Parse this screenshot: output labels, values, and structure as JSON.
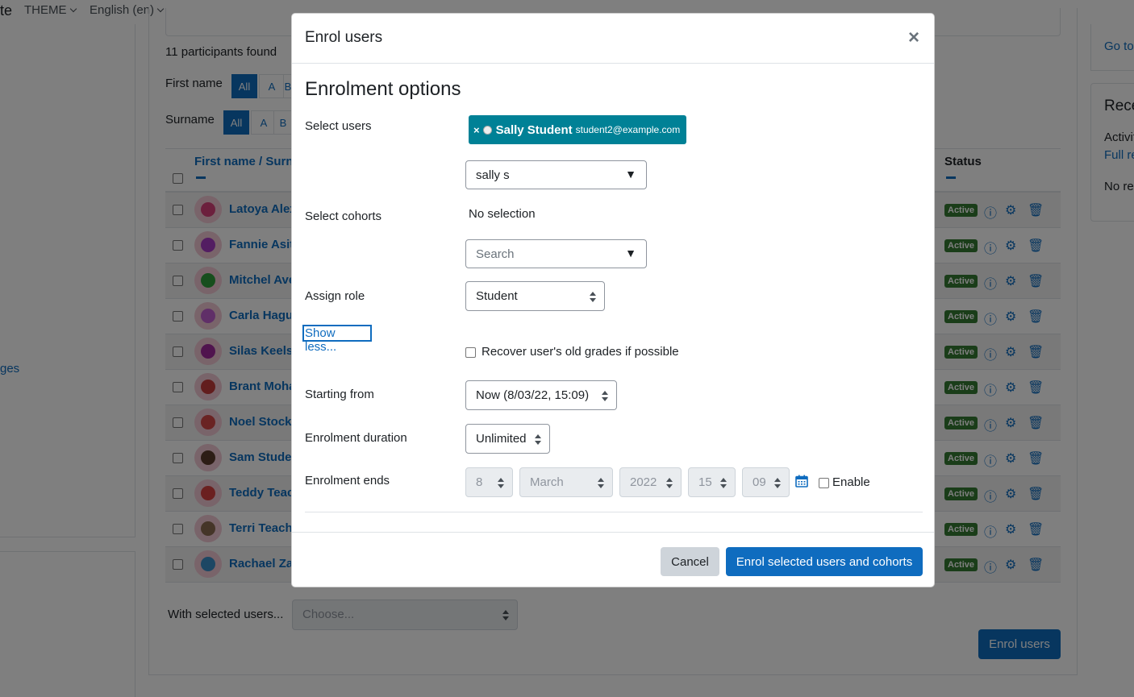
{
  "topbar": {
    "site_fragment": "te",
    "theme_label": "THEME",
    "language_label": "English (en)"
  },
  "left": {
    "link_fragment": "ges"
  },
  "participants": {
    "found": "11 participants found",
    "first_name_label": "First name",
    "surname_label": "Surname",
    "first_initials": [
      "All",
      "A",
      "B"
    ],
    "surname_initials": [
      "All",
      "A",
      "B"
    ],
    "col_name": "First name / Surn",
    "col_status": "Status",
    "rows": [
      {
        "name": "Latoya Alex",
        "status": "Active",
        "color": "#d8407a"
      },
      {
        "name": "Fannie Asit",
        "status": "Active",
        "color": "#a63ac4"
      },
      {
        "name": "Mitchel Ave",
        "status": "Active",
        "color": "#2e9c3a"
      },
      {
        "name": "Carla Hagu",
        "status": "Active",
        "color": "#c05fd0"
      },
      {
        "name": "Silas Keels",
        "status": "Active",
        "color": "#a0289c"
      },
      {
        "name": "Brant Moha",
        "status": "Active",
        "color": "#c43a3a"
      },
      {
        "name": "Noel Stock",
        "status": "Active",
        "color": "#d44646"
      },
      {
        "name": "Sam Stude",
        "status": "Active",
        "color": "#5a3a2a"
      },
      {
        "name": "Teddy Teac",
        "status": "Active",
        "color": "#d64040"
      },
      {
        "name": "Terri Teach",
        "status": "Active",
        "color": "#8a6a50"
      },
      {
        "name": "Rachael Za",
        "status": "Active",
        "color": "#3a8ec8"
      }
    ],
    "with_selected": "With selected users...",
    "choose_placeholder": "Choose...",
    "enrol_users_button": "Enrol users"
  },
  "right": {
    "goto": "Go to",
    "recent_title": "Rece",
    "activity": "Activit",
    "full_report": "Full re",
    "no_recent": "No re"
  },
  "modal": {
    "title": "Enrol users",
    "close": "×",
    "heading": "Enrolment options",
    "select_users_label": "Select users",
    "selected_user": {
      "remove": "×",
      "name": "Sally Student",
      "email": "student2@example.com"
    },
    "user_search_value": "sally s",
    "select_cohorts_label": "Select cohorts",
    "cohorts_none": "No selection",
    "cohort_search_placeholder": "Search",
    "assign_role_label": "Assign role",
    "assign_role_value": "Student",
    "show_less": "Show less...",
    "recover_grades_label": "Recover user's old grades if possible",
    "starting_from_label": "Starting from",
    "starting_from_value": "Now (8/03/22, 15:09)",
    "duration_label": "Enrolment duration",
    "duration_value": "Unlimited",
    "ends_label": "Enrolment ends",
    "ends": {
      "day": "8",
      "month": "March",
      "year": "2022",
      "hour": "15",
      "minute": "09"
    },
    "enable_label": "Enable",
    "cancel_button": "Cancel",
    "submit_button": "Enrol selected users and cohorts",
    "dropdown_arrow": "▼"
  },
  "colors": {
    "accent": "#0f6cbf",
    "chip": "#008196",
    "active_badge": "#357a32"
  }
}
